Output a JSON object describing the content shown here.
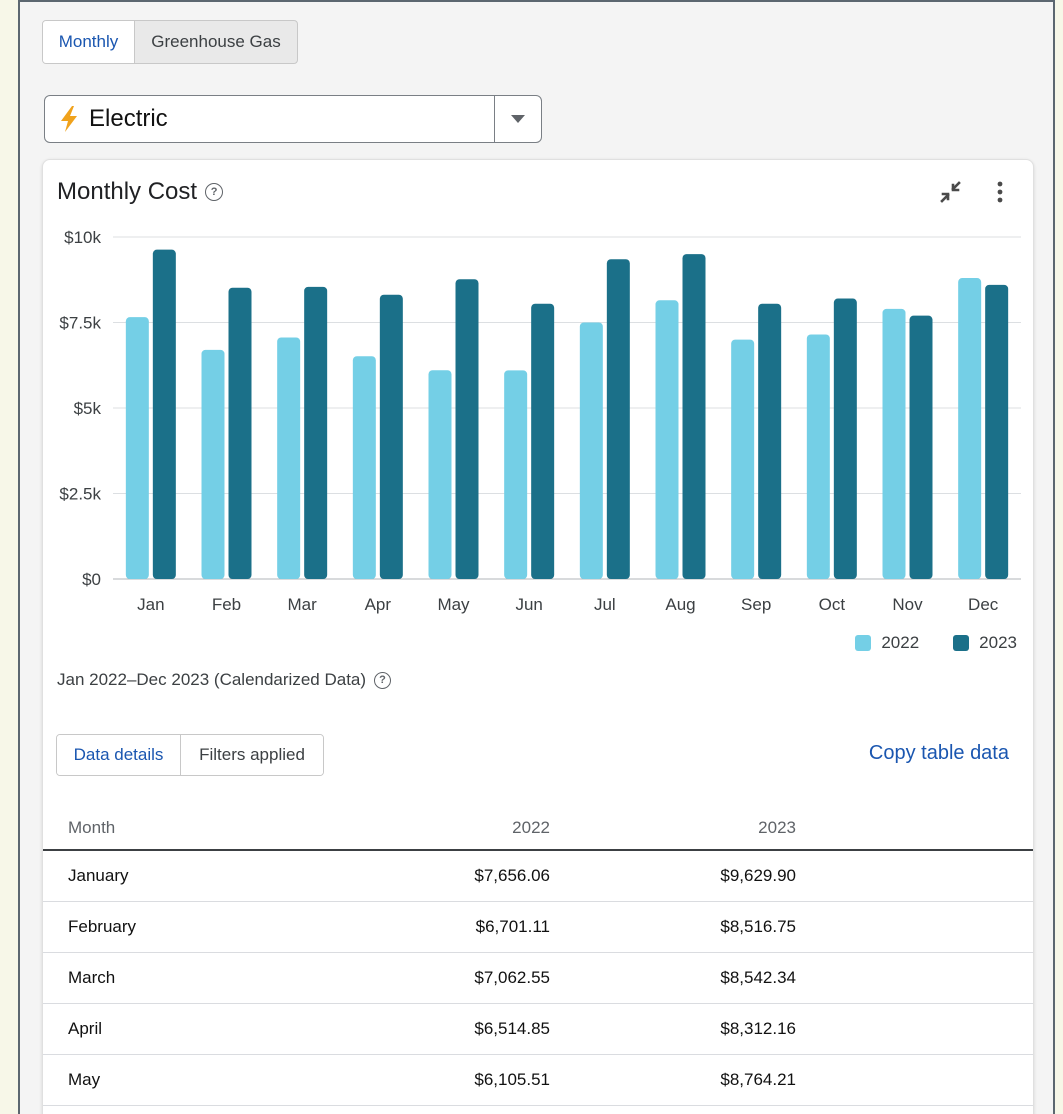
{
  "view_tabs": {
    "monthly": "Monthly",
    "greenhouse": "Greenhouse Gas"
  },
  "meter_select": {
    "value": "Electric",
    "icon": "lightning-bolt-icon"
  },
  "card": {
    "title": "Monthly Cost",
    "date_range": "Jan 2022–Dec 2023 (Calendarized Data)"
  },
  "colors": {
    "series_2022": "#74cfe6",
    "series_2023": "#1b7089",
    "link": "#1a56b0"
  },
  "chart_data": {
    "type": "bar",
    "categories": [
      "Jan",
      "Feb",
      "Mar",
      "Apr",
      "May",
      "Jun",
      "Jul",
      "Aug",
      "Sep",
      "Oct",
      "Nov",
      "Dec"
    ],
    "series": [
      {
        "name": "2022",
        "values": [
          7656.06,
          6701.11,
          7062.55,
          6514.85,
          6105.51,
          6100,
          7500,
          8150,
          7000,
          7150,
          7900,
          8800
        ]
      },
      {
        "name": "2023",
        "values": [
          9629.9,
          8516.75,
          8542.34,
          8312.16,
          8764.21,
          8050,
          9350,
          9500,
          8050,
          8200,
          7700,
          8600
        ]
      }
    ],
    "ylim": [
      0,
      10000
    ],
    "yticks": [
      0,
      2500,
      5000,
      7500,
      10000
    ],
    "ytick_labels": [
      "$0",
      "$2.5k",
      "$5k",
      "$7.5k",
      "$10k"
    ],
    "grid": true,
    "legend_position": "bottom-right"
  },
  "details": {
    "tab_details": "Data details",
    "tab_filters": "Filters applied",
    "copy_label": "Copy table data"
  },
  "table": {
    "headers": {
      "month": "Month",
      "y2022": "2022",
      "y2023": "2023"
    },
    "rows": [
      {
        "month": "January",
        "y2022": "$7,656.06",
        "y2023": "$9,629.90"
      },
      {
        "month": "February",
        "y2022": "$6,701.11",
        "y2023": "$8,516.75"
      },
      {
        "month": "March",
        "y2022": "$7,062.55",
        "y2023": "$8,542.34"
      },
      {
        "month": "April",
        "y2022": "$6,514.85",
        "y2023": "$8,312.16"
      },
      {
        "month": "May",
        "y2022": "$6,105.51",
        "y2023": "$8,764.21"
      }
    ]
  }
}
